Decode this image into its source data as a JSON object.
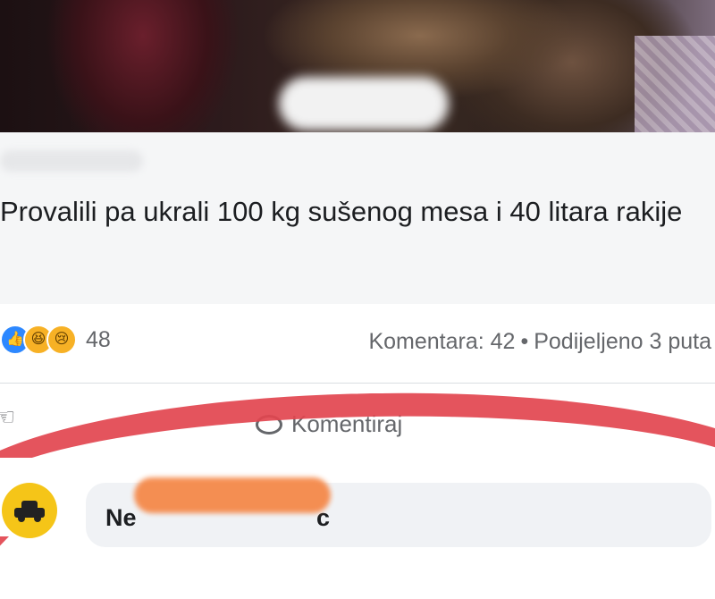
{
  "post": {
    "title": "Provalili pa ukrali 100 kg sušenog mesa i 40 litara rakije"
  },
  "stats": {
    "reaction_count": "48",
    "comments": "Komentara: 42",
    "separator": "•",
    "shares": "Podijeljeno 3 puta"
  },
  "actions": {
    "comment_label": "Komentiraj"
  },
  "comment": {
    "author_start": "Ne",
    "author_end": "c"
  },
  "colors": {
    "facebook_blue": "#2d88ff",
    "text_primary": "#1c1e21",
    "text_secondary": "#65676b",
    "highlight_red": "#e24650"
  },
  "icons": {
    "like": "like-icon",
    "haha": "haha-icon",
    "sad": "sad-icon",
    "comment": "comment-icon",
    "taxi": "taxi-icon"
  }
}
